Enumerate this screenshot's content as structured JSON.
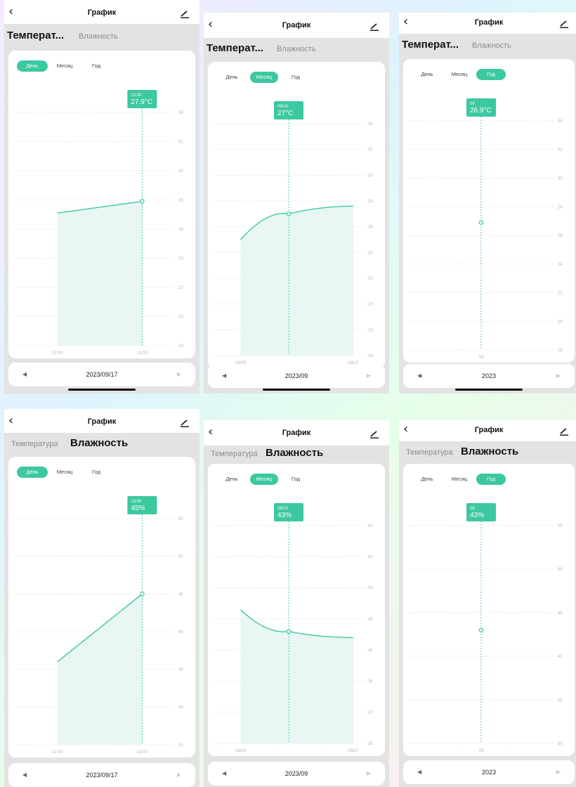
{
  "nav_title": "График",
  "tabs": {
    "temperature_full": "Температура",
    "temperature_short": "Температ...",
    "humidity": "Влажность"
  },
  "segments": {
    "day": "День",
    "month": "Месяц",
    "year": "Год"
  },
  "colors": {
    "accent": "#3cc8a0",
    "fill": "#e8f6f4",
    "grid": "#e2e2e2"
  },
  "icons": {
    "back": "chevron-left-icon",
    "edit": "edit-pencil-icon",
    "prev": "triangle-left-icon",
    "next": "triangle-right-icon"
  },
  "panels": [
    {
      "active_tab": "temperature",
      "active_segment": "day",
      "date": "2023/09/17",
      "tooltip": {
        "label": "13:00",
        "value": "27.9°C"
      }
    },
    {
      "active_tab": "temperature",
      "active_segment": "month",
      "date": "2023/09",
      "tooltip": {
        "label": "09/10",
        "value": "27°C"
      }
    },
    {
      "active_tab": "temperature",
      "active_segment": "year",
      "date": "2023",
      "tooltip": {
        "label": "09",
        "value": "26.9°C"
      }
    },
    {
      "active_tab": "humidity",
      "active_segment": "day",
      "date": "2023/09/17",
      "tooltip": {
        "label": "13:00",
        "value": "45%"
      }
    },
    {
      "active_tab": "humidity",
      "active_segment": "month",
      "date": "2023/09",
      "tooltip": {
        "label": "09/10",
        "value": "43%"
      }
    },
    {
      "active_tab": "humidity",
      "active_segment": "year",
      "date": "2023",
      "tooltip": {
        "label": "09",
        "value": "43%"
      }
    }
  ],
  "chart_data": [
    {
      "type": "area",
      "x": [
        "12:00",
        "13:00"
      ],
      "ylim": [
        18,
        34
      ],
      "yticks": [
        "34",
        "32",
        "30",
        "28",
        "26",
        "24",
        "22",
        "20",
        "18"
      ],
      "xticks": [
        "12:00",
        "13:00"
      ],
      "series": [
        {
          "values": [
            27.1,
            27.9
          ]
        }
      ],
      "selected_index": 1,
      "grid": true
    },
    {
      "type": "area",
      "x": [
        "09/09",
        "09/10",
        "09/17"
      ],
      "ylim": [
        16,
        34
      ],
      "yticks": [
        "34",
        "32",
        "30",
        "28",
        "26",
        "24",
        "22",
        "20",
        "18",
        "16"
      ],
      "xticks": [
        "09/09",
        "09/17"
      ],
      "series": [
        {
          "values": [
            25,
            27,
            27.6
          ]
        }
      ],
      "selected_index": 1,
      "grid": true
    },
    {
      "type": "line",
      "x": [
        "09"
      ],
      "ylim": [
        18,
        34
      ],
      "yticks": [
        "34",
        "32",
        "30",
        "28",
        "26",
        "24",
        "22",
        "20",
        "18"
      ],
      "xticks": [
        "09"
      ],
      "series": [
        {
          "values": [
            26.9
          ]
        }
      ],
      "selected_index": 0,
      "grid": true
    },
    {
      "type": "area",
      "x": [
        "12:00",
        "13:00"
      ],
      "ylim": [
        25,
        55
      ],
      "yticks": [
        "55",
        "50",
        "45",
        "40",
        "35",
        "30",
        "25"
      ],
      "xticks": [
        "12:00",
        "13:00"
      ],
      "series": [
        {
          "values": [
            36,
            45
          ]
        }
      ],
      "selected_index": 1,
      "grid": true
    },
    {
      "type": "area",
      "x": [
        "09/09",
        "09/10",
        "09/17"
      ],
      "ylim": [
        25,
        60
      ],
      "yticks": [
        "60",
        "55",
        "50",
        "45",
        "40",
        "35",
        "30",
        "25"
      ],
      "xticks": [
        "09/09",
        "09/17"
      ],
      "series": [
        {
          "values": [
            46.5,
            43,
            42
          ]
        }
      ],
      "selected_index": 1,
      "grid": true
    },
    {
      "type": "line",
      "x": [
        "09"
      ],
      "ylim": [
        30,
        55
      ],
      "yticks": [
        "55",
        "50",
        "45",
        "40",
        "35",
        "30"
      ],
      "xticks": [
        "09"
      ],
      "series": [
        {
          "values": [
            43
          ]
        }
      ],
      "selected_index": 0,
      "grid": true
    }
  ]
}
